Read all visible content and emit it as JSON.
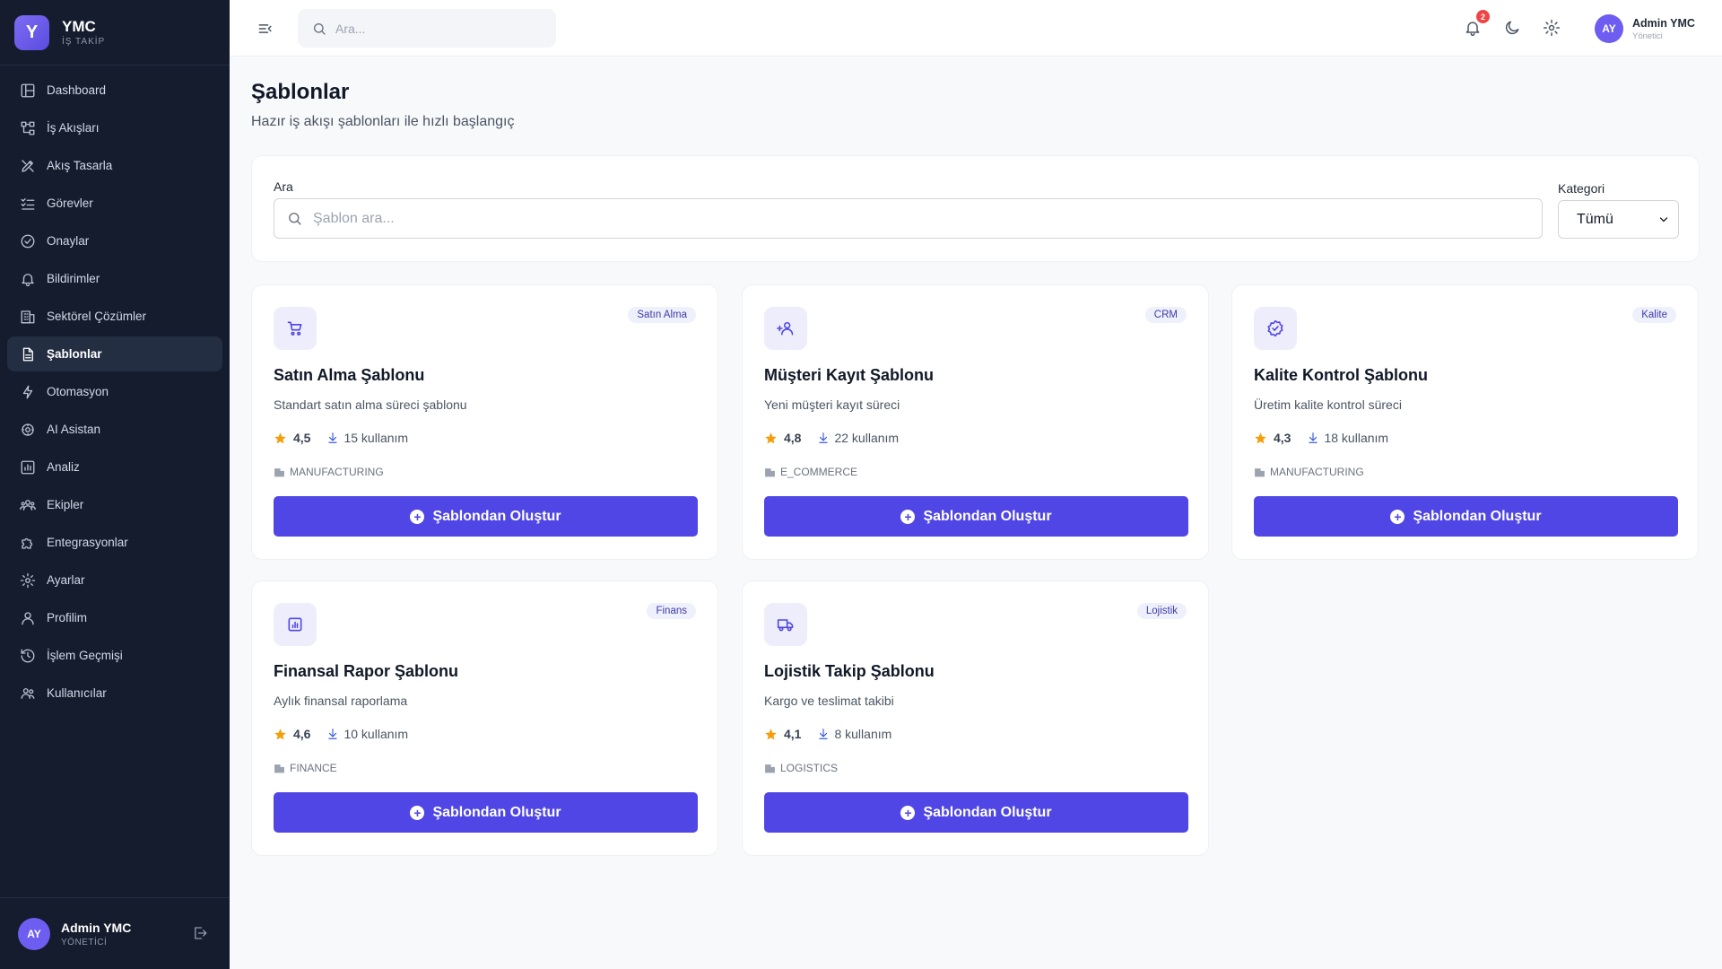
{
  "brand": {
    "logo_letter": "Y",
    "name": "YMC",
    "subtitle": "İŞ TAKİP"
  },
  "sidebar": {
    "items": [
      {
        "label": "Dashboard",
        "icon": "dashboard-icon"
      },
      {
        "label": "İş Akışları",
        "icon": "workflow-icon"
      },
      {
        "label": "Akış Tasarla",
        "icon": "design-icon"
      },
      {
        "label": "Görevler",
        "icon": "tasks-icon"
      },
      {
        "label": "Onaylar",
        "icon": "approval-icon"
      },
      {
        "label": "Bildirimler",
        "icon": "bell-icon"
      },
      {
        "label": "Sektörel Çözümler",
        "icon": "building-icon"
      },
      {
        "label": "Şablonlar",
        "icon": "document-icon",
        "active": true
      },
      {
        "label": "Otomasyon",
        "icon": "bolt-icon"
      },
      {
        "label": "AI Asistan",
        "icon": "ai-icon"
      },
      {
        "label": "Analiz",
        "icon": "chart-icon"
      },
      {
        "label": "Ekipler",
        "icon": "team-icon"
      },
      {
        "label": "Entegrasyonlar",
        "icon": "puzzle-icon"
      },
      {
        "label": "Ayarlar",
        "icon": "gear-icon"
      },
      {
        "label": "Profilim",
        "icon": "user-icon"
      },
      {
        "label": "İşlem Geçmişi",
        "icon": "history-icon"
      },
      {
        "label": "Kullanıcılar",
        "icon": "users-icon"
      }
    ],
    "user": {
      "initials": "AY",
      "name": "Admin YMC",
      "role": "YÖNETİCİ"
    }
  },
  "topbar": {
    "search_placeholder": "Ara...",
    "notification_count": "2",
    "user": {
      "initials": "AY",
      "name": "Admin YMC",
      "role": "Yönetici"
    }
  },
  "page": {
    "title": "Şablonlar",
    "subtitle": "Hazır iş akışı şablonları ile hızlı başlangıç"
  },
  "filters": {
    "search_label": "Ara",
    "search_placeholder": "Şablon ara...",
    "category_label": "Kategori",
    "category_value": "Tümü"
  },
  "templates": [
    {
      "title": "Satın Alma Şablonu",
      "desc": "Standart satın alma süreci şablonu",
      "tag": "Satın Alma",
      "rating": "4,5",
      "usage": "15 kullanım",
      "sector": "MANUFACTURING",
      "icon": "cart-icon",
      "button": "Şablondan Oluştur"
    },
    {
      "title": "Müşteri Kayıt Şablonu",
      "desc": "Yeni müşteri kayıt süreci",
      "tag": "CRM",
      "rating": "4,8",
      "usage": "22 kullanım",
      "sector": "E_COMMERCE",
      "icon": "user-add-icon",
      "button": "Şablondan Oluştur"
    },
    {
      "title": "Kalite Kontrol Şablonu",
      "desc": "Üretim kalite kontrol süreci",
      "tag": "Kalite",
      "rating": "4,3",
      "usage": "18 kullanım",
      "sector": "MANUFACTURING",
      "icon": "verified-icon",
      "button": "Şablondan Oluştur"
    },
    {
      "title": "Finansal Rapor Şablonu",
      "desc": "Aylık finansal raporlama",
      "tag": "Finans",
      "rating": "4,6",
      "usage": "10 kullanım",
      "sector": "FINANCE",
      "icon": "report-icon",
      "button": "Şablondan Oluştur"
    },
    {
      "title": "Lojistik Takip Şablonu",
      "desc": "Kargo ve teslimat takibi",
      "tag": "Lojistik",
      "rating": "4,1",
      "usage": "8 kullanım",
      "sector": "LOGISTICS",
      "icon": "truck-icon",
      "button": "Şablondan Oluştur"
    }
  ],
  "colors": {
    "sidebar_bg": "#141c2e",
    "accent": "#4f46e5",
    "badge": "#ef4444",
    "star": "#f59e0b"
  }
}
